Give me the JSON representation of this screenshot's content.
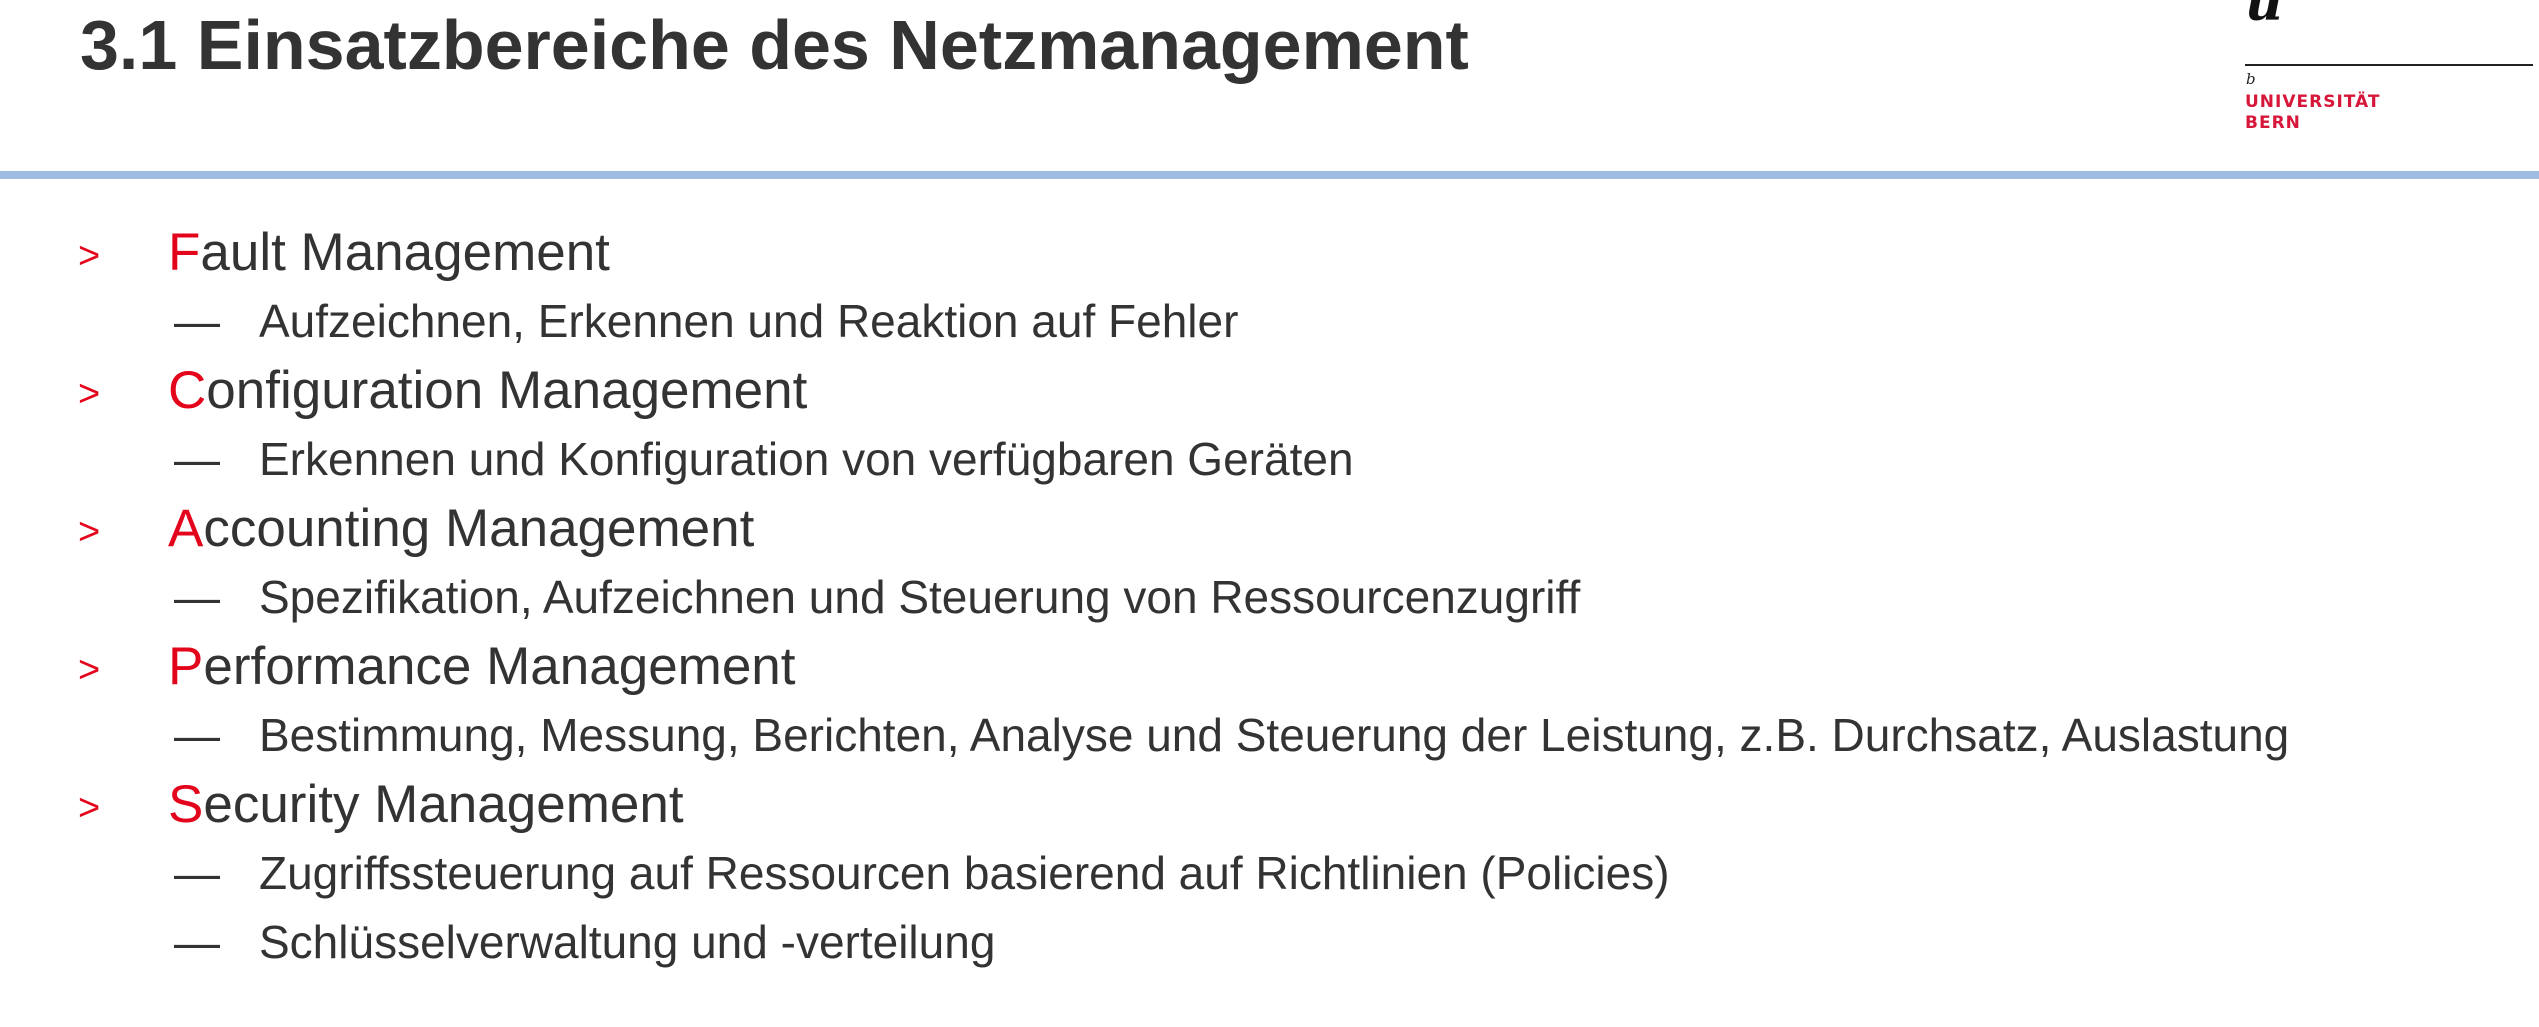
{
  "title": "3.1 Einsatzbereiche des Netzmanagement",
  "logo": {
    "mark": "u",
    "superscript": "b",
    "line1": "UNIVERSITÄT",
    "line2": "BERN"
  },
  "bullets": {
    "arrow": ">",
    "dash": "—"
  },
  "items": [
    {
      "initial": "F",
      "rest": "ault Management",
      "subs": [
        "Aufzeichnen, Erkennen und Reaktion auf Fehler"
      ]
    },
    {
      "initial": "C",
      "rest": "onfiguration Management",
      "subs": [
        "Erkennen und Konfiguration von verfügbaren Geräten"
      ]
    },
    {
      "initial": "A",
      "rest": "ccounting Management",
      "subs": [
        "Spezifikation, Aufzeichnen und Steuerung von Ressourcenzugriff"
      ]
    },
    {
      "initial": "P",
      "rest": "erformance Management",
      "subs": [
        "Bestimmung, Messung, Berichten, Analyse und Steuerung der Leistung, z.B. Durchsatz, Auslastung"
      ]
    },
    {
      "initial": "S",
      "rest": "ecurity Management",
      "subs": [
        "Zugriffssteuerung auf Ressourcen basierend auf Richtlinien (Policies)",
        "Schlüsselverwaltung und -verteilung"
      ]
    }
  ],
  "colors": {
    "accent": "#e3051b",
    "text": "#333333",
    "rule": "#9dbcdf",
    "logo_red": "#d6173a"
  }
}
